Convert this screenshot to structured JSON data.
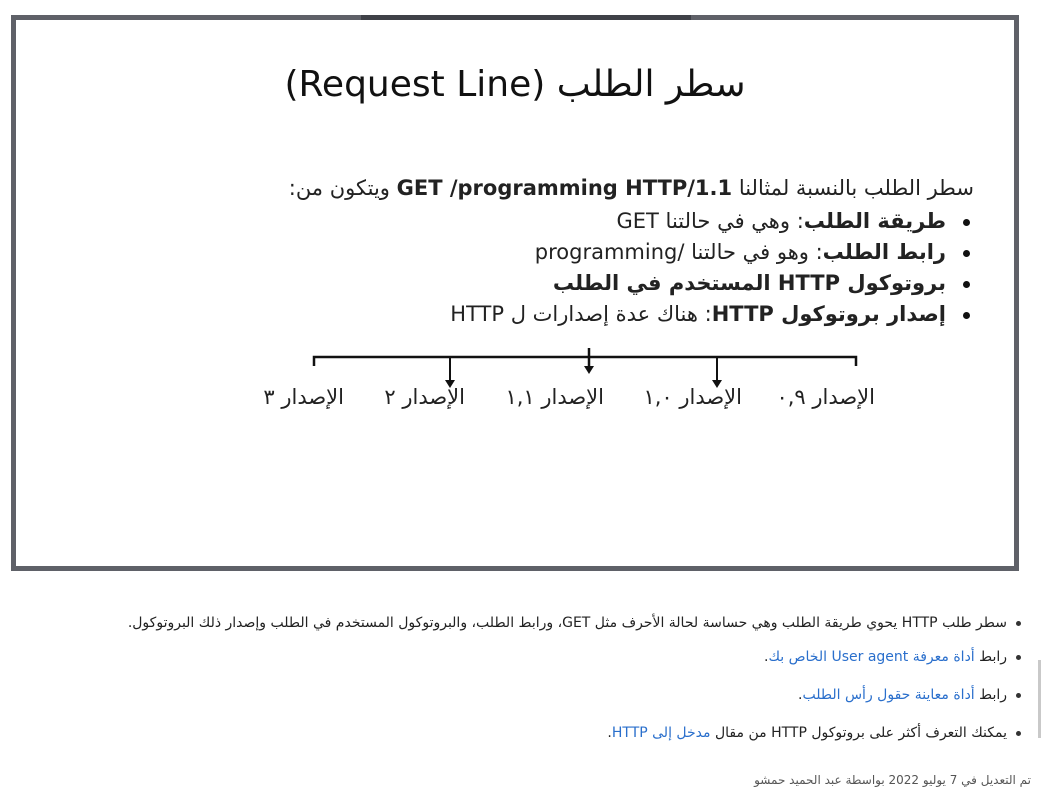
{
  "slide": {
    "title": "سطر الطلب (Request Line)",
    "intro_a": "سطر الطلب بالنسبة لمثالنا",
    "intro_b": "GET /programming HTTP/1.1",
    "intro_c": "ويتكون من:",
    "items": [
      {
        "label": "طريقة الطلب",
        "text": ": وهي في حالتنا GET"
      },
      {
        "label": "رابط الطلب",
        "text": ": وهو في حالتنا /programming"
      },
      {
        "label": "بروتوكول HTTP المستخدم في الطلب",
        "text": ""
      },
      {
        "label": "إصدار بروتوكول HTTP",
        "text": ": هناك عدة إصدارات ل HTTP"
      }
    ],
    "versions": [
      "الإصدار ٠,٩",
      "الإصدار ١,٠",
      "الإصدار ١,١",
      "الإصدار ٢",
      "الإصدار ٣"
    ]
  },
  "notes": {
    "n1": "سطر طلب HTTP يحوي طريقة الطلب وهي حساسة لحالة الأحرف مثل GET، ورابط الطلب، والبروتوكول المستخدم في الطلب وإصدار ذلك البروتوكول.",
    "n2_pre": "رابط ",
    "n2_link": "أداة معرفة User agent الخاص بك",
    "n2_post": ".",
    "n3_pre": "رابط ",
    "n3_link": "أداة معاينة حقول رأس الطلب",
    "n3_post": ".",
    "n4_pre": "يمكنك التعرف أكثر على بروتوكول HTTP من مقال ",
    "n4_link": "مدخل إلى HTTP",
    "n4_post": "."
  },
  "footer": "تم التعديل في 7 يوليو 2022 بواسطة عبد الحميد حمشو"
}
